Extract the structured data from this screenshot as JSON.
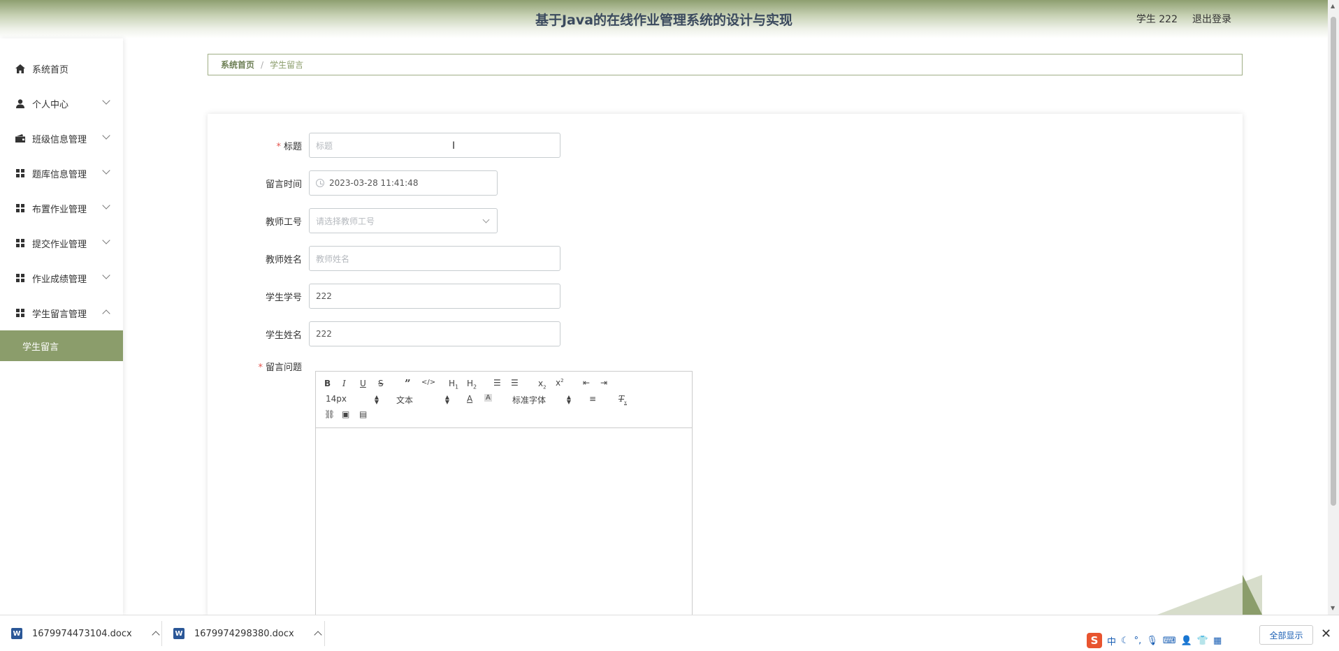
{
  "header": {
    "title": "基于Java的在线作业管理系统的设计与实现",
    "user": "学生 222",
    "logout": "退出登录"
  },
  "sidebar": {
    "items": [
      {
        "label": "系统首页",
        "icon": "home-icon"
      },
      {
        "label": "个人中心",
        "icon": "user-icon"
      },
      {
        "label": "班级信息管理",
        "icon": "wallet-icon"
      },
      {
        "label": "题库信息管理",
        "icon": "grid-icon"
      },
      {
        "label": "布置作业管理",
        "icon": "grid-icon"
      },
      {
        "label": "提交作业管理",
        "icon": "grid-icon"
      },
      {
        "label": "作业成绩管理",
        "icon": "grid-icon"
      },
      {
        "label": "学生留言管理",
        "icon": "grid-icon"
      }
    ],
    "sub_item": "学生留言"
  },
  "breadcrumb": {
    "home": "系统首页",
    "separator": "/",
    "current": "学生留言"
  },
  "form": {
    "title": {
      "label": "标题",
      "placeholder": "标题"
    },
    "time": {
      "label": "留言时间",
      "value": "2023-03-28 11:41:48"
    },
    "teacher_id": {
      "label": "教师工号",
      "placeholder": "请选择教师工号"
    },
    "teacher_name": {
      "label": "教师姓名",
      "placeholder": "教师姓名"
    },
    "student_id": {
      "label": "学生学号",
      "value": "222"
    },
    "student_name": {
      "label": "学生姓名",
      "value": "222"
    },
    "question": {
      "label": "留言问题"
    }
  },
  "editor": {
    "font_size": "14px",
    "text_style": "文本",
    "font_family": "标准字体"
  },
  "downloads": {
    "items": [
      "1679974473104.docx",
      "1679974298380.docx"
    ],
    "show_all": "全部显示",
    "tray_ime": "中"
  },
  "colors": {
    "accent": "#8b9d6b",
    "required": "#e5554f"
  }
}
